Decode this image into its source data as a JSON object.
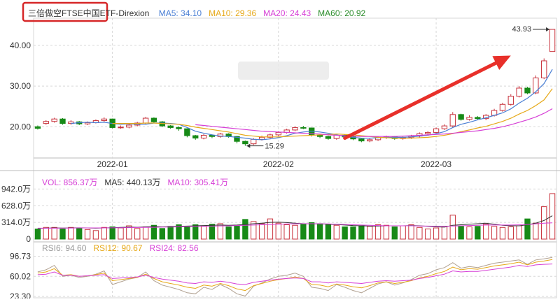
{
  "header": {
    "title": "三倍做空FTSE中国ETF-Direxion",
    "ma_items": [
      {
        "label": "MA5: 34.10",
        "color": "#4a7fd4"
      },
      {
        "label": "MA10: 29.36",
        "color": "#e6a817"
      },
      {
        "label": "MA20: 24.43",
        "color": "#d63fd6"
      },
      {
        "label": "MA60: 20.92",
        "color": "#2b8c2b"
      }
    ]
  },
  "volume_legend": [
    {
      "label": "VOL: 856.37万",
      "color": "#d63fd6"
    },
    {
      "label": "MA5: 440.13万",
      "color": "#333333"
    },
    {
      "label": "MA10: 305.41万",
      "color": "#d63fd6"
    }
  ],
  "rsi_legend": [
    {
      "label": "RSI6: 94.60",
      "color": "#999999"
    },
    {
      "label": "RSI12: 90.67",
      "color": "#e6a817"
    },
    {
      "label": "RSI24: 82.56",
      "color": "#d63fd6"
    }
  ],
  "annotations": {
    "high": "43.93",
    "low": "15.29"
  },
  "colors": {
    "up": "#c8323c",
    "down": "#178a17",
    "grid": "#d7d7d7",
    "arrow": "#e8302a",
    "box": "#d62728"
  },
  "chart_data": [
    {
      "type": "candlestick",
      "x_ticks": [
        "2022-01",
        "2022-02",
        "2022-03"
      ],
      "x_tick_positions": [
        9,
        29,
        48
      ],
      "y_ticks": [
        "20.00",
        "30.00",
        "40.00"
      ],
      "y_tick_values": [
        20,
        30,
        40
      ],
      "ylim": [
        13,
        46
      ],
      "candles": [
        [
          20.0,
          19.6,
          20.3,
          19.3
        ],
        [
          20.8,
          21.3,
          21.6,
          20.5
        ],
        [
          21.3,
          21.9,
          22.2,
          21.0
        ],
        [
          21.9,
          20.8,
          22.1,
          20.5
        ],
        [
          20.8,
          21.2,
          21.6,
          20.5
        ],
        [
          21.2,
          20.7,
          21.4,
          20.4
        ],
        [
          20.7,
          21.0,
          21.3,
          20.4
        ],
        [
          21.0,
          21.5,
          21.8,
          20.8
        ],
        [
          21.5,
          21.9,
          22.3,
          21.2
        ],
        [
          21.9,
          19.8,
          22.0,
          19.6
        ],
        [
          19.8,
          19.9,
          20.3,
          19.5
        ],
        [
          19.9,
          20.4,
          20.8,
          19.6
        ],
        [
          20.4,
          20.9,
          21.2,
          20.1
        ],
        [
          20.9,
          22.1,
          22.4,
          20.6
        ],
        [
          22.1,
          21.2,
          22.3,
          20.9
        ],
        [
          21.2,
          20.2,
          21.4,
          19.9
        ],
        [
          20.2,
          19.8,
          20.4,
          19.5
        ],
        [
          19.8,
          19.5,
          20.1,
          19.0
        ],
        [
          19.5,
          17.8,
          19.6,
          17.4
        ],
        [
          17.8,
          17.2,
          18.0,
          16.8
        ],
        [
          17.2,
          17.9,
          18.2,
          16.9
        ],
        [
          17.9,
          17.6,
          18.1,
          17.2
        ],
        [
          17.6,
          18.2,
          18.5,
          17.3
        ],
        [
          18.2,
          17.6,
          18.4,
          17.3
        ],
        [
          17.6,
          16.4,
          17.7,
          15.9
        ],
        [
          16.4,
          15.8,
          16.6,
          15.3
        ],
        [
          15.8,
          16.9,
          17.2,
          15.5
        ],
        [
          16.9,
          17.4,
          17.8,
          16.6
        ],
        [
          17.4,
          18.0,
          18.3,
          17.1
        ],
        [
          18.0,
          18.6,
          18.9,
          17.7
        ],
        [
          18.6,
          19.2,
          19.5,
          18.3
        ],
        [
          19.2,
          19.8,
          20.1,
          18.9
        ],
        [
          19.8,
          19.7,
          20.2,
          19.4
        ],
        [
          19.7,
          18.0,
          19.8,
          17.6
        ],
        [
          18.0,
          17.6,
          18.2,
          17.2
        ],
        [
          17.6,
          17.1,
          17.8,
          16.8
        ],
        [
          17.1,
          17.9,
          18.2,
          16.8
        ],
        [
          17.9,
          17.5,
          18.1,
          17.2
        ],
        [
          17.5,
          17.0,
          17.7,
          16.7
        ],
        [
          17.0,
          16.5,
          17.2,
          16.2
        ],
        [
          16.5,
          16.8,
          17.1,
          16.2
        ],
        [
          16.8,
          17.3,
          17.6,
          16.5
        ],
        [
          17.3,
          17.5,
          17.8,
          17.0
        ],
        [
          17.5,
          17.1,
          17.7,
          16.8
        ],
        [
          17.1,
          17.3,
          17.6,
          16.8
        ],
        [
          17.3,
          17.7,
          18.0,
          17.0
        ],
        [
          17.7,
          18.3,
          18.6,
          17.4
        ],
        [
          18.3,
          18.6,
          18.9,
          18.0
        ],
        [
          18.6,
          19.5,
          19.8,
          18.3
        ],
        [
          19.5,
          20.2,
          20.6,
          19.2
        ],
        [
          20.2,
          23.0,
          23.6,
          19.9
        ],
        [
          23.0,
          21.8,
          23.2,
          21.5
        ],
        [
          21.8,
          22.3,
          22.8,
          21.5
        ],
        [
          22.3,
          22.0,
          22.6,
          21.7
        ],
        [
          22.0,
          22.8,
          23.1,
          21.6
        ],
        [
          22.8,
          24.0,
          24.4,
          22.5
        ],
        [
          24.0,
          25.5,
          25.9,
          23.7
        ],
        [
          25.5,
          27.5,
          28.0,
          25.2
        ],
        [
          27.5,
          29.5,
          30.0,
          27.2
        ],
        [
          29.5,
          28.3,
          29.8,
          28.0
        ],
        [
          28.3,
          32.0,
          32.6,
          28.0
        ],
        [
          32.0,
          36.2,
          36.8,
          31.7
        ],
        [
          38.5,
          43.93,
          43.93,
          39.0
        ]
      ],
      "ma5": [
        null,
        null,
        null,
        null,
        20.8,
        21.0,
        21.1,
        21.0,
        21.1,
        20.8,
        20.6,
        20.7,
        20.6,
        20.6,
        20.9,
        20.9,
        20.8,
        20.6,
        19.8,
        18.9,
        18.4,
        18.0,
        17.7,
        17.6,
        17.4,
        17.2,
        16.9,
        16.8,
        17.0,
        17.3,
        17.8,
        18.4,
        18.7,
        18.9,
        18.7,
        18.4,
        18.0,
        17.6,
        17.4,
        17.2,
        17.2,
        17.3,
        17.4,
        17.4,
        17.4,
        17.5,
        17.7,
        17.9,
        18.3,
        18.8,
        19.8,
        20.6,
        21.1,
        21.7,
        22.2,
        22.8,
        23.4,
        24.4,
        25.8,
        27.0,
        28.6,
        30.6,
        34.1
      ],
      "ma10": [
        null,
        null,
        null,
        null,
        null,
        null,
        null,
        null,
        null,
        20.8,
        20.8,
        20.8,
        20.8,
        20.9,
        20.9,
        20.8,
        20.7,
        20.6,
        20.3,
        19.9,
        19.6,
        19.3,
        19.0,
        18.7,
        18.3,
        17.9,
        17.7,
        17.5,
        17.5,
        17.5,
        17.6,
        17.7,
        17.8,
        17.9,
        18.0,
        18.1,
        18.2,
        18.1,
        18.0,
        17.8,
        17.6,
        17.4,
        17.3,
        17.2,
        17.2,
        17.2,
        17.3,
        17.4,
        17.6,
        17.9,
        18.3,
        18.8,
        19.2,
        19.7,
        20.1,
        20.7,
        21.3,
        22.1,
        23.1,
        24.0,
        25.2,
        26.6,
        29.36
      ],
      "ma20": [
        null,
        null,
        null,
        null,
        null,
        null,
        null,
        null,
        null,
        null,
        null,
        null,
        null,
        null,
        null,
        null,
        null,
        null,
        null,
        20.5,
        20.3,
        20.1,
        19.9,
        19.7,
        19.5,
        19.3,
        19.1,
        18.9,
        18.8,
        18.7,
        18.6,
        18.5,
        18.4,
        18.3,
        18.2,
        18.0,
        17.9,
        17.8,
        17.7,
        17.6,
        17.6,
        17.6,
        17.6,
        17.6,
        17.7,
        17.8,
        17.9,
        18.0,
        18.1,
        18.2,
        18.4,
        18.6,
        18.8,
        19.0,
        19.3,
        19.6,
        20.0,
        20.5,
        21.1,
        21.7,
        22.4,
        23.3,
        24.43
      ],
      "ma60": [
        null,
        null,
        null,
        null,
        null,
        null,
        null,
        null,
        null,
        null,
        null,
        null,
        null,
        null,
        null,
        null,
        null,
        null,
        null,
        null,
        null,
        null,
        null,
        null,
        null,
        null,
        null,
        null,
        null,
        null,
        null,
        null,
        null,
        null,
        null,
        null,
        null,
        null,
        null,
        null,
        null,
        null,
        null,
        null,
        null,
        null,
        null,
        null,
        null,
        null,
        null,
        null,
        null,
        null,
        null,
        null,
        null,
        null,
        null,
        null,
        null,
        null,
        20.92
      ]
    },
    {
      "type": "bar",
      "y_ticks": [
        "942.0万",
        "628.0万",
        "314.0万",
        "0"
      ],
      "y_tick_values": [
        942,
        628,
        314,
        0
      ],
      "ylim": [
        0,
        1000
      ],
      "values": [
        190,
        220,
        220,
        190,
        220,
        210,
        180,
        160,
        220,
        230,
        210,
        250,
        200,
        230,
        260,
        200,
        240,
        270,
        240,
        270,
        250,
        280,
        290,
        230,
        250,
        370,
        330,
        290,
        380,
        300,
        270,
        260,
        290,
        310,
        290,
        270,
        260,
        230,
        230,
        250,
        240,
        270,
        260,
        230,
        250,
        270,
        220,
        190,
        210,
        230,
        450,
        240,
        230,
        240,
        280,
        240,
        220,
        230,
        250,
        380,
        300,
        610,
        856
      ],
      "ma5": [
        200,
        205,
        210,
        208,
        210,
        212,
        210,
        205,
        210,
        215,
        220,
        225,
        222,
        230,
        235,
        230,
        235,
        240,
        245,
        250,
        255,
        260,
        265,
        260,
        265,
        275,
        290,
        300,
        315,
        320,
        310,
        300,
        290,
        285,
        285,
        280,
        275,
        265,
        255,
        250,
        245,
        245,
        250,
        250,
        250,
        255,
        250,
        240,
        230,
        225,
        260,
        270,
        280,
        290,
        300,
        280,
        260,
        250,
        250,
        270,
        300,
        350,
        440
      ],
      "ma10": [
        205,
        205,
        205,
        206,
        208,
        210,
        210,
        210,
        210,
        212,
        214,
        216,
        218,
        220,
        222,
        225,
        228,
        230,
        235,
        238,
        240,
        243,
        246,
        250,
        255,
        260,
        265,
        270,
        275,
        280,
        285,
        288,
        290,
        290,
        288,
        285,
        280,
        275,
        270,
        265,
        260,
        255,
        250,
        250,
        250,
        250,
        248,
        245,
        242,
        240,
        245,
        250,
        255,
        260,
        265,
        265,
        265,
        265,
        268,
        275,
        285,
        300,
        305
      ]
    },
    {
      "type": "line",
      "y_ticks": [
        "96.73",
        "60.02",
        "23.30"
      ],
      "y_tick_values": [
        96.73,
        60.02,
        23.3
      ],
      "ylim": [
        23.3,
        100
      ],
      "rsi6": [
        68,
        72,
        80,
        60,
        62,
        58,
        60,
        64,
        70,
        45,
        50,
        55,
        58,
        68,
        52,
        44,
        40,
        36,
        30,
        28,
        40,
        36,
        45,
        38,
        28,
        24,
        42,
        48,
        55,
        60,
        62,
        66,
        60,
        40,
        38,
        34,
        45,
        40,
        34,
        30,
        38,
        46,
        50,
        44,
        48,
        54,
        62,
        65,
        72,
        76,
        85,
        75,
        78,
        76,
        80,
        84,
        86,
        88,
        90,
        82,
        90,
        92,
        94.6
      ],
      "rsi12": [
        66,
        68,
        74,
        62,
        63,
        60,
        61,
        63,
        66,
        52,
        54,
        56,
        58,
        64,
        56,
        50,
        47,
        44,
        40,
        38,
        44,
        42,
        47,
        43,
        37,
        34,
        43,
        47,
        51,
        54,
        56,
        59,
        56,
        45,
        44,
        41,
        46,
        44,
        41,
        39,
        43,
        48,
        50,
        47,
        49,
        52,
        57,
        60,
        65,
        69,
        77,
        72,
        74,
        73,
        76,
        79,
        81,
        83,
        86,
        81,
        86,
        88,
        90.67
      ],
      "rsi24": [
        63,
        64,
        68,
        62,
        62,
        60,
        61,
        62,
        63,
        56,
        57,
        58,
        59,
        62,
        58,
        55,
        53,
        51,
        48,
        47,
        50,
        49,
        51,
        49,
        46,
        45,
        49,
        51,
        53,
        55,
        56,
        57,
        56,
        50,
        50,
        48,
        50,
        49,
        48,
        47,
        49,
        51,
        52,
        51,
        52,
        53,
        56,
        58,
        61,
        64,
        70,
        68,
        69,
        69,
        71,
        73,
        75,
        77,
        80,
        78,
        81,
        82,
        82.56
      ]
    }
  ]
}
